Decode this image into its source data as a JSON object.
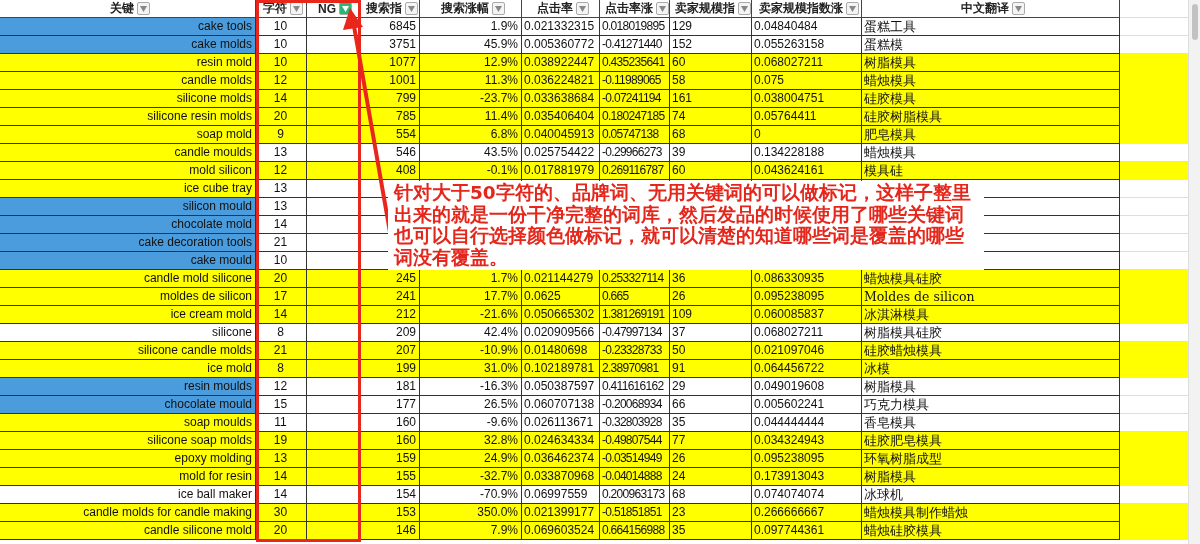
{
  "sheet": {
    "columns": [
      {
        "label": "关键",
        "filtered": false
      },
      {
        "label": "字符",
        "filtered": false
      },
      {
        "label": "NG",
        "filtered": true
      },
      {
        "label": "搜索指",
        "filtered": false
      },
      {
        "label": "搜索涨幅",
        "filtered": false
      },
      {
        "label": "点击率",
        "filtered": false
      },
      {
        "label": "点击率涨",
        "filtered": false
      },
      {
        "label": "卖家规模指",
        "filtered": false
      },
      {
        "label": "卖家规模指数涨",
        "filtered": false
      },
      {
        "label": "中文翻译",
        "filtered": false
      }
    ],
    "rows": [
      {
        "keyword": "cake tools",
        "color": "#4a9cdc",
        "highlighted": false,
        "chars": "10",
        "search_index": "6845",
        "search_growth": "1.9%",
        "ctr": "0.021332315",
        "ctr_growth": "0.018019895",
        "sellers": "129",
        "sellers_growth": "0.04840484",
        "translation": "蛋糕工具"
      },
      {
        "keyword": "cake molds",
        "color": "#4a9cdc",
        "highlighted": false,
        "chars": "10",
        "search_index": "3751",
        "search_growth": "45.9%",
        "ctr": "0.005360772",
        "ctr_growth": "-0.41271440",
        "sellers": "152",
        "sellers_growth": "0.055263158",
        "translation": "蛋糕模"
      },
      {
        "keyword": "resin mold",
        "color": "#ffff00",
        "highlighted": true,
        "chars": "10",
        "search_index": "1077",
        "search_growth": "12.9%",
        "ctr": "0.038922447",
        "ctr_growth": "0.435235641",
        "sellers": "60",
        "sellers_growth": "0.068027211",
        "translation": "树脂模具"
      },
      {
        "keyword": "candle molds",
        "color": "#ffff00",
        "highlighted": true,
        "chars": "12",
        "search_index": "1001",
        "search_growth": "11.3%",
        "ctr": "0.036224821",
        "ctr_growth": "-0.11989065",
        "sellers": "58",
        "sellers_growth": "0.075",
        "translation": "蜡烛模具"
      },
      {
        "keyword": "silicone molds",
        "color": "#ffff00",
        "highlighted": true,
        "chars": "14",
        "search_index": "799",
        "search_growth": "-23.7%",
        "ctr": "0.033638684",
        "ctr_growth": "-0.07241194",
        "sellers": "161",
        "sellers_growth": "0.038004751",
        "translation": "硅胶模具"
      },
      {
        "keyword": "silicone resin molds",
        "color": "#ffff00",
        "highlighted": true,
        "chars": "20",
        "search_index": "785",
        "search_growth": "11.4%",
        "ctr": "0.035406404",
        "ctr_growth": "0.180247185",
        "sellers": "74",
        "sellers_growth": "0.05764411",
        "translation": "硅胶树脂模具"
      },
      {
        "keyword": "soap mold",
        "color": "#ffff00",
        "highlighted": true,
        "chars": "9",
        "search_index": "554",
        "search_growth": "6.8%",
        "ctr": "0.040045913",
        "ctr_growth": "0.05747138",
        "sellers": "68",
        "sellers_growth": "0",
        "translation": "肥皂模具"
      },
      {
        "keyword": "candle moulds",
        "color": "#ffff00",
        "highlighted": false,
        "chars": "13",
        "search_index": "546",
        "search_growth": "43.5%",
        "ctr": "0.025754422",
        "ctr_growth": "-0.29966273",
        "sellers": "39",
        "sellers_growth": "0.134228188",
        "translation": "蜡烛模具"
      },
      {
        "keyword": "mold silicon",
        "color": "#ffff00",
        "highlighted": true,
        "chars": "12",
        "search_index": "408",
        "search_growth": "-0.1%",
        "ctr": "0.017881979",
        "ctr_growth": "0.269116787",
        "sellers": "60",
        "sellers_growth": "0.043624161",
        "translation": "模具硅"
      },
      {
        "keyword": "ice cube tray",
        "color": "#ffff00",
        "highlighted": false,
        "chars": "13"
      },
      {
        "keyword": "silicon mould",
        "color": "#4a9cdc",
        "highlighted": false,
        "chars": "13"
      },
      {
        "keyword": "chocolate mold",
        "color": "#4a9cdc",
        "highlighted": false,
        "chars": "14"
      },
      {
        "keyword": "cake decoration tools",
        "color": "#4a9cdc",
        "highlighted": false,
        "chars": "21"
      },
      {
        "keyword": "cake mould",
        "color": "#4a9cdc",
        "highlighted": false,
        "chars": "10"
      },
      {
        "keyword": "candle mold silicone",
        "color": "#ffff00",
        "highlighted": true,
        "chars": "20",
        "search_index": "245",
        "search_growth": "1.7%",
        "ctr": "0.021144279",
        "ctr_growth": "0.253327114",
        "sellers": "36",
        "sellers_growth": "0.086330935",
        "translation": "蜡烛模具硅胶"
      },
      {
        "keyword": "moldes de silicon",
        "color": "#ffff00",
        "highlighted": true,
        "chars": "17",
        "search_index": "241",
        "search_growth": "17.7%",
        "ctr": "0.0625",
        "ctr_growth": "0.665",
        "sellers": "26",
        "sellers_growth": "0.095238095",
        "translation": "Moldes de silicon"
      },
      {
        "keyword": "ice cream mold",
        "color": "#ffff00",
        "highlighted": true,
        "chars": "14",
        "search_index": "212",
        "search_growth": "-21.6%",
        "ctr": "0.050665302",
        "ctr_growth": "1.381269191",
        "sellers": "109",
        "sellers_growth": "0.060085837",
        "translation": "冰淇淋模具"
      },
      {
        "keyword": "silicone",
        "color": "#ffffff",
        "highlighted": false,
        "chars": "8",
        "search_index": "209",
        "search_growth": "42.4%",
        "ctr": "0.020909566",
        "ctr_growth": "-0.47997134",
        "sellers": "37",
        "sellers_growth": "0.068027211",
        "translation": "树脂模具硅胶"
      },
      {
        "keyword": "silicone candle molds",
        "color": "#ffff00",
        "highlighted": true,
        "chars": "21",
        "search_index": "207",
        "search_growth": "-10.9%",
        "ctr": "0.01480698",
        "ctr_growth": "-0.23328733",
        "sellers": "50",
        "sellers_growth": "0.021097046",
        "translation": "硅胶蜡烛模具"
      },
      {
        "keyword": "ice mold",
        "color": "#ffff00",
        "highlighted": true,
        "chars": "8",
        "search_index": "199",
        "search_growth": "31.0%",
        "ctr": "0.102189781",
        "ctr_growth": "2.38970981",
        "sellers": "91",
        "sellers_growth": "0.064456722",
        "translation": "冰模"
      },
      {
        "keyword": "resin moulds",
        "color": "#4a9cdc",
        "highlighted": false,
        "chars": "12",
        "search_index": "181",
        "search_growth": "-16.3%",
        "ctr": "0.050387597",
        "ctr_growth": "0.411616162",
        "sellers": "29",
        "sellers_growth": "0.049019608",
        "translation": "树脂模具"
      },
      {
        "keyword": "chocolate mould",
        "color": "#4a9cdc",
        "highlighted": false,
        "chars": "15",
        "search_index": "177",
        "search_growth": "26.5%",
        "ctr": "0.060707138",
        "ctr_growth": "-0.20068934",
        "sellers": "66",
        "sellers_growth": "0.005602241",
        "translation": "巧克力模具"
      },
      {
        "keyword": "soap moulds",
        "color": "#ffff00",
        "highlighted": false,
        "chars": "11",
        "search_index": "160",
        "search_growth": "-9.6%",
        "ctr": "0.026113671",
        "ctr_growth": "-0.32803928",
        "sellers": "35",
        "sellers_growth": "0.044444444",
        "translation": "香皂模具"
      },
      {
        "keyword": "silicone soap molds",
        "color": "#ffff00",
        "highlighted": true,
        "chars": "19",
        "search_index": "160",
        "search_growth": "32.8%",
        "ctr": "0.024634334",
        "ctr_growth": "-0.49807544",
        "sellers": "77",
        "sellers_growth": "0.034324943",
        "translation": "硅胶肥皂模具"
      },
      {
        "keyword": "epoxy molding",
        "color": "#ffff00",
        "highlighted": true,
        "chars": "13",
        "search_index": "159",
        "search_growth": "24.9%",
        "ctr": "0.036462374",
        "ctr_growth": "-0.03514949",
        "sellers": "26",
        "sellers_growth": "0.095238095",
        "translation": "环氧树脂成型"
      },
      {
        "keyword": "mold for resin",
        "color": "#ffff00",
        "highlighted": true,
        "chars": "14",
        "search_index": "155",
        "search_growth": "-32.7%",
        "ctr": "0.033870968",
        "ctr_growth": "-0.04014888",
        "sellers": "24",
        "sellers_growth": "0.173913043",
        "translation": "树脂模具"
      },
      {
        "keyword": "ice ball maker",
        "color": "#ffffff",
        "highlighted": false,
        "chars": "14",
        "search_index": "154",
        "search_growth": "-70.9%",
        "ctr": "0.06997559",
        "ctr_growth": "0.200963173",
        "sellers": "68",
        "sellers_growth": "0.074074074",
        "translation": "冰球机"
      },
      {
        "keyword": "candle molds for candle making",
        "color": "#ffff00",
        "highlighted": true,
        "chars": "30",
        "search_index": "153",
        "search_growth": "350.0%",
        "ctr": "0.021399177",
        "ctr_growth": "-0.51851851",
        "sellers": "23",
        "sellers_growth": "0.266666667",
        "translation": "蜡烛模具制作蜡烛"
      },
      {
        "keyword": "candle silicone mold",
        "color": "#ffff00",
        "highlighted": true,
        "chars": "20",
        "search_index": "146",
        "search_growth": "7.9%",
        "ctr": "0.069603524",
        "ctr_growth": "0.664156988",
        "sellers": "35",
        "sellers_growth": "0.097744361",
        "translation": "蜡烛硅胶模具"
      }
    ]
  },
  "note": {
    "text": "针对大于50字符的、品牌词、无用关键词的可以做标记，这样子整里出来的就是一份干净完整的词库，然后发品的时候使用了哪些关键词也可以自行选择颜色做标记，就可以清楚的知道哪些词是覆盖的哪些词没有覆盖。"
  }
}
